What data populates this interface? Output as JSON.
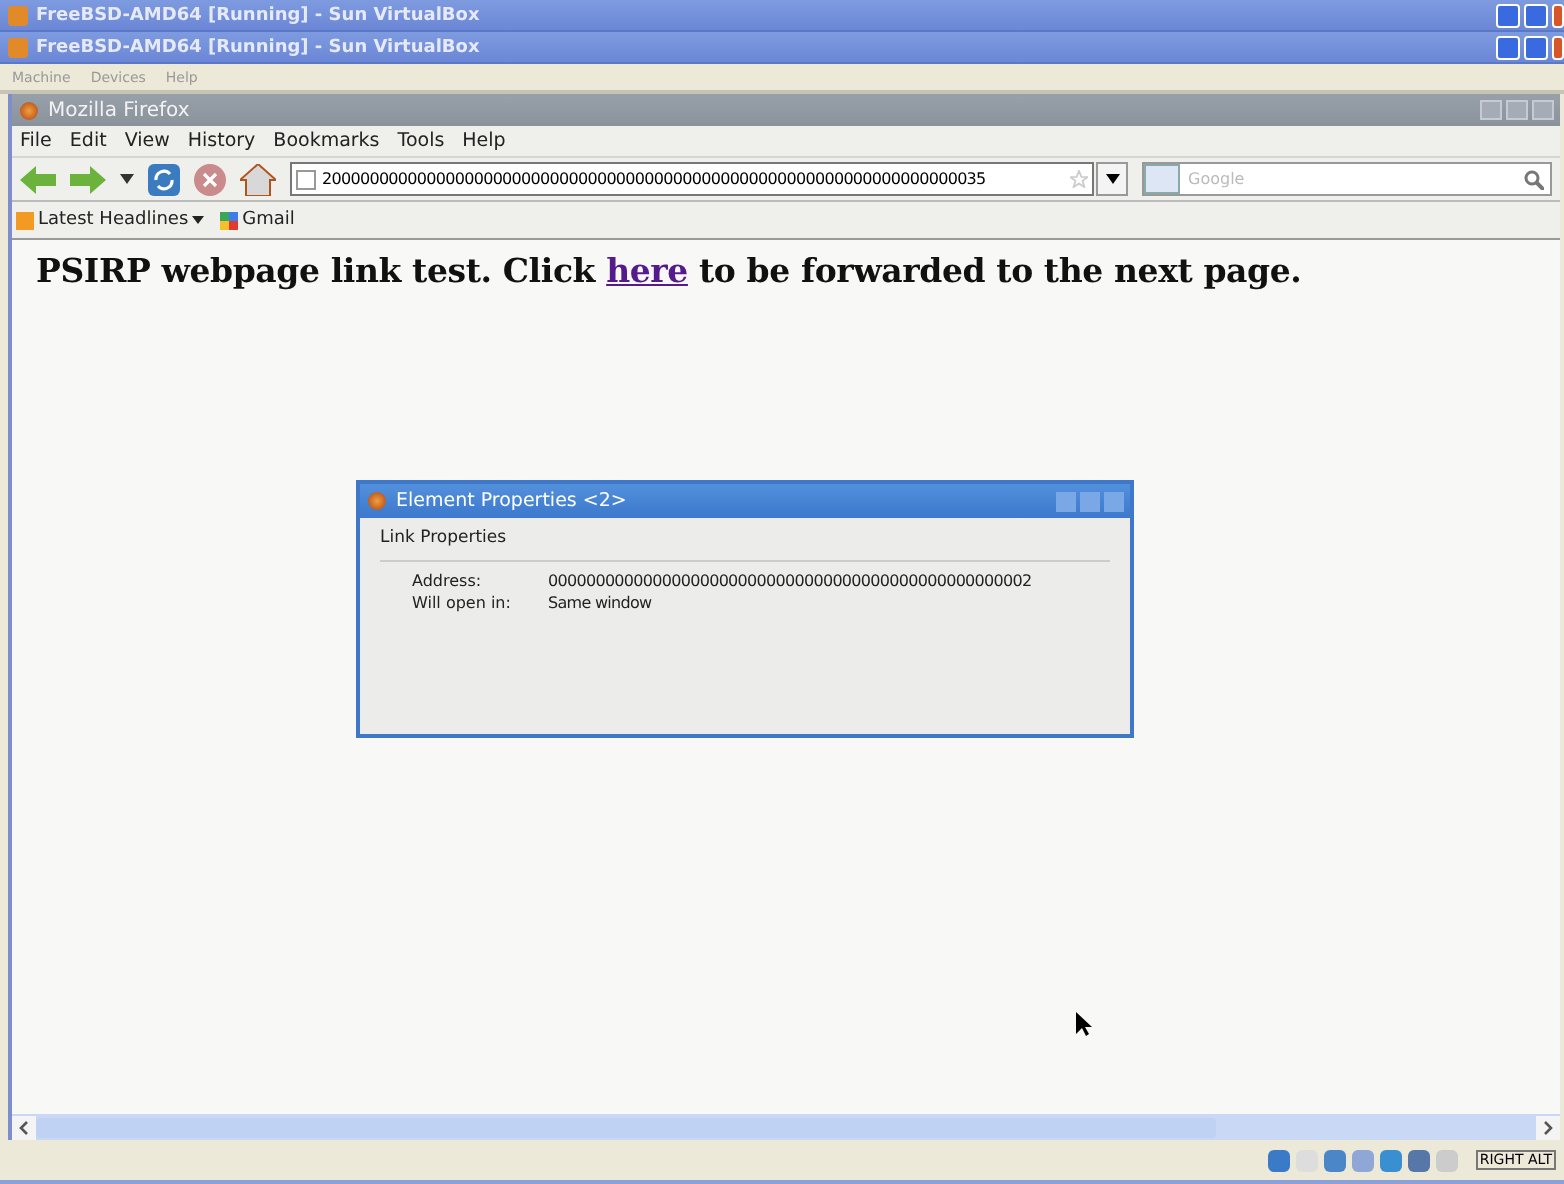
{
  "vbox_windows": [
    {
      "title": "FreeBSD-AMD64 [Running] - Sun VirtualBox"
    },
    {
      "title": "FreeBSD-AMD64 [Running] - Sun VirtualBox"
    }
  ],
  "vbox_menu": [
    "Machine",
    "Devices",
    "Help"
  ],
  "firefox": {
    "title": "Mozilla Firefox",
    "menu": [
      "File",
      "Edit",
      "View",
      "History",
      "Bookmarks",
      "Tools",
      "Help"
    ],
    "address": "2000000000000000000000000000000000000000000000000000000000000000000035",
    "search_placeholder": "Google",
    "bookmarks": [
      {
        "label": "Latest Headlines",
        "kind": "feed"
      },
      {
        "label": "Gmail",
        "kind": "site"
      }
    ],
    "page": {
      "before": "PSIRP webpage link test. Click ",
      "link": "here",
      "after": " to be forwarded to the next page."
    }
  },
  "dialog": {
    "title": "Element Properties <2>",
    "section": "Link Properties",
    "rows": [
      {
        "label": "Address:",
        "value": "000000000000000000000000000000000000000000000000002"
      },
      {
        "label": "Will open in:",
        "value": "Same window"
      }
    ]
  },
  "status_bar": {
    "host_key": "RIGHT ALT"
  }
}
